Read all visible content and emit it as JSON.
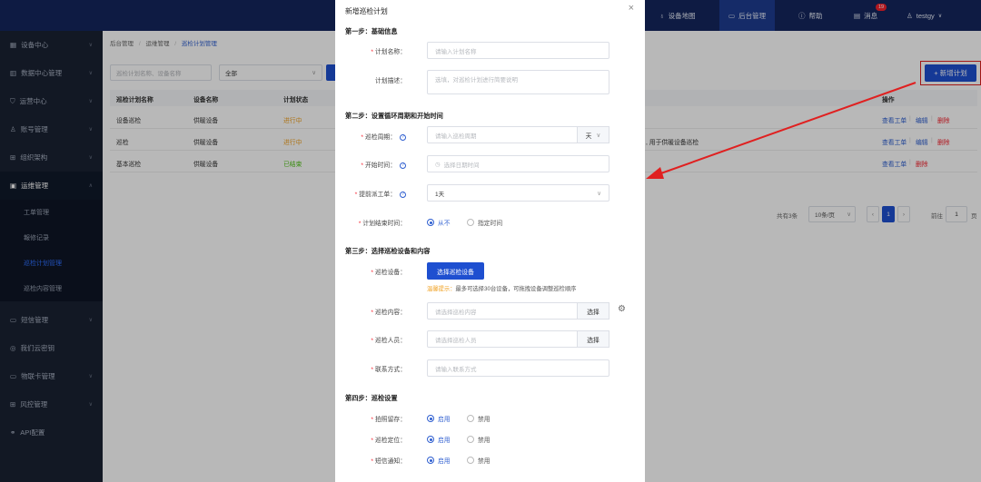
{
  "header": {
    "nav": [
      {
        "label": "设备地图",
        "icon": "map-pin-icon"
      },
      {
        "label": "后台管理",
        "icon": "monitor-icon"
      },
      {
        "label": "帮助",
        "icon": "help-circle-icon"
      },
      {
        "label": "消息",
        "icon": "message-icon",
        "badge": "19"
      },
      {
        "label": "testgy",
        "icon": "user-icon"
      }
    ]
  },
  "sidebar": {
    "items": [
      {
        "label": "设备中心",
        "icon": "device-icon"
      },
      {
        "label": "数据中心管理",
        "icon": "bar-chart-icon"
      },
      {
        "label": "运营中心",
        "icon": "shield-icon"
      },
      {
        "label": "账号管理",
        "icon": "users-icon"
      },
      {
        "label": "组织架构",
        "icon": "org-icon"
      },
      {
        "label": "运维管理",
        "icon": "tools-icon"
      },
      {
        "label": "短信管理",
        "icon": "sms-icon"
      },
      {
        "label": "我们云密钥",
        "icon": "key-icon"
      },
      {
        "label": "物联卡管理",
        "icon": "card-icon"
      },
      {
        "label": "风控管理",
        "icon": "grid-icon"
      },
      {
        "label": "API配置",
        "icon": "link-icon"
      }
    ],
    "sub_items": [
      {
        "label": "工单管理"
      },
      {
        "label": "報修记录"
      },
      {
        "label": "巡检计划管理"
      },
      {
        "label": "巡检内容管理"
      }
    ]
  },
  "main": {
    "breadcrumb": [
      "后台管理",
      "运维管理",
      "巡检计划管理"
    ],
    "filter": {
      "search_placeholder": "巡检计划名称、设备名称",
      "status_value": "全部"
    },
    "add_button": "+ 新增计划",
    "table": {
      "headers": [
        "巡检计划名称",
        "设备名称",
        "计划状态",
        "操作"
      ],
      "rows": [
        {
          "name": "设备巡检",
          "device": "供暖设备",
          "status": "进行中",
          "desc": "",
          "actions": [
            "查看工单",
            "编辑",
            "删除"
          ]
        },
        {
          "name": "巡检",
          "device": "供暖设备",
          "status": "进行中",
          "desc": ", 用于供暖设备巡检",
          "actions": [
            "查看工单",
            "编辑",
            "删除"
          ]
        },
        {
          "name": "基本巡检",
          "device": "供暖设备",
          "status": "已结束",
          "desc": "",
          "actions": [
            "查看工单",
            "删除"
          ]
        }
      ]
    },
    "pagination": {
      "total": "共有3条",
      "page_size": "10条/页",
      "current": "1",
      "goto": "前往",
      "goto_value": "1",
      "page_unit": "页"
    }
  },
  "drawer": {
    "title": "新增巡检计划",
    "step1": {
      "title": "第一步：基础信息",
      "name_label": "计划名称：",
      "name_placeholder": "请输入计划名称",
      "desc_label": "计划描述：",
      "desc_placeholder": "选填，对巡检计划进行简要说明"
    },
    "step2": {
      "title": "第二步：设置循环周期和开始时间",
      "cycle_label": "巡检周期：",
      "cycle_placeholder": "请输入巡检周期",
      "cycle_unit": "天",
      "start_label": "开始时间：",
      "start_placeholder": "选择日期时间",
      "advance_label": "提前派工单：",
      "advance_value": "1天",
      "end_label": "计划结束时间：",
      "end_options": [
        "从不",
        "指定时间"
      ]
    },
    "step3": {
      "title": "第三步：选择巡检设备和内容",
      "device_label": "巡检设备：",
      "device_button": "选择巡检设备",
      "tip_warn": "温馨提示：",
      "tip_text": "最多可选择30台设备，可拖拽设备调整巡检顺序",
      "content_label": "巡检内容：",
      "content_placeholder": "请选择巡检内容",
      "content_button": "选择",
      "staff_label": "巡检人员：",
      "staff_placeholder": "请选择巡检人员",
      "staff_button": "选择",
      "contact_label": "联系方式：",
      "contact_placeholder": "请输入联系方式"
    },
    "step4": {
      "title": "第四步：巡检设置",
      "photo_label": "拍照留存：",
      "locate_label": "巡检定位：",
      "sms_label": "短信通知：",
      "options": [
        "启用",
        "禁用"
      ]
    }
  }
}
